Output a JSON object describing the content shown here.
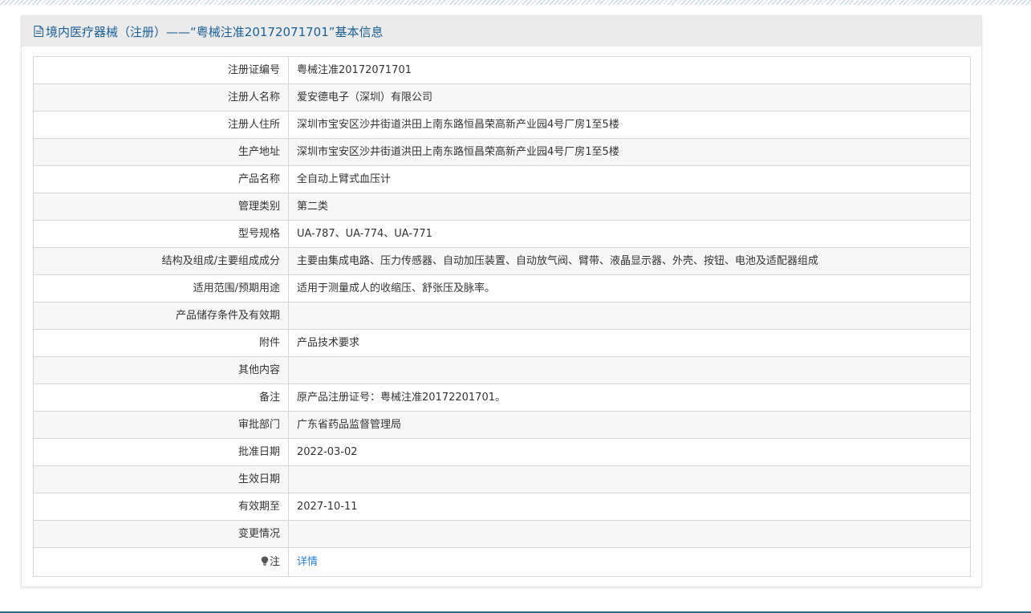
{
  "page": {
    "header_title": "境内医疗器械（注册）——“粤械注准20172071701”基本信息"
  },
  "colors": {
    "header_text": "#1b5f97",
    "link": "#2a7fd0",
    "border": "#d7d7d7"
  },
  "rows": [
    {
      "label": "注册证编号",
      "value": "粤械注准20172071701"
    },
    {
      "label": "注册人名称",
      "value": "爱安德电子（深圳）有限公司"
    },
    {
      "label": "注册人住所",
      "value": "深圳市宝安区沙井街道洪田上南东路恒昌荣高新产业园4号厂房1至5楼"
    },
    {
      "label": "生产地址",
      "value": "深圳市宝安区沙井街道洪田上南东路恒昌荣高新产业园4号厂房1至5楼"
    },
    {
      "label": "产品名称",
      "value": "全自动上臂式血压计"
    },
    {
      "label": "管理类别",
      "value": "第二类"
    },
    {
      "label": "型号规格",
      "value": "UA-787、UA-774、UA-771"
    },
    {
      "label": "结构及组成/主要组成成分",
      "value": "主要由集成电路、压力传感器、自动加压装置、自动放气阀、臂带、液晶显示器、外壳、按钮、电池及适配器组成"
    },
    {
      "label": "适用范围/预期用途",
      "value": "适用于测量成人的收缩压、舒张压及脉率。"
    },
    {
      "label": "产品储存条件及有效期",
      "value": ""
    },
    {
      "label": "附件",
      "value": "产品技术要求"
    },
    {
      "label": "其他内容",
      "value": ""
    },
    {
      "label": "备注",
      "value": "原产品注册证号：粤械注准20172201701。"
    },
    {
      "label": "审批部门",
      "value": "广东省药品监督管理局"
    },
    {
      "label": "批准日期",
      "value": "2022-03-02"
    },
    {
      "label": "生效日期",
      "value": ""
    },
    {
      "label": "有效期至",
      "value": "2027-10-11"
    },
    {
      "label": "变更情况",
      "value": ""
    }
  ],
  "note_row": {
    "icon": "lightbulb-icon",
    "label": "注",
    "link_text": "详情"
  }
}
